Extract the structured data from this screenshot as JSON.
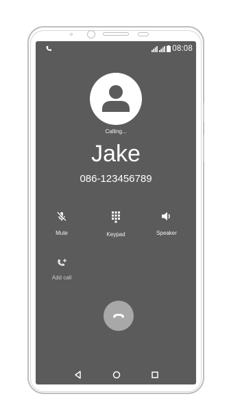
{
  "status_bar": {
    "time": "08:08",
    "left_icon": "phone-icon",
    "right_icons": [
      "signal-icon",
      "signal-icon",
      "battery-icon"
    ]
  },
  "call": {
    "status_text": "Calling...",
    "contact_name": "Jake",
    "phone_number": "086-123456789",
    "avatar_icon": "person-icon"
  },
  "controls": [
    {
      "id": "mute",
      "label": "Mute",
      "icon": "mic-off-icon"
    },
    {
      "id": "keypad",
      "label": "Keypad",
      "icon": "dialpad-icon"
    },
    {
      "id": "speaker",
      "label": "Speaker",
      "icon": "speaker-icon"
    },
    {
      "id": "add_call",
      "label": "Add call",
      "icon": "add-call-icon"
    }
  ],
  "hangup_icon": "end-call-icon",
  "nav": {
    "back_icon": "back-triangle-icon",
    "home_icon": "home-circle-icon",
    "recents_icon": "recents-square-icon"
  },
  "colors": {
    "screen_bg": "#5b5b5b",
    "hangup_bg": "#a8a8a8",
    "avatar_bg": "#ffffff",
    "frame": "#bdbdbd"
  }
}
